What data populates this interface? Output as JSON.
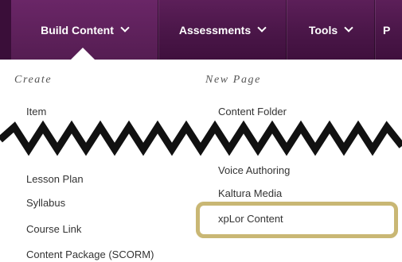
{
  "menu": {
    "tabs": [
      {
        "label": "Build Content",
        "active": true
      },
      {
        "label": "Assessments"
      },
      {
        "label": "Tools"
      },
      {
        "label": "P"
      }
    ]
  },
  "dropdown": {
    "create_heading": "Create",
    "new_page_heading": "New Page",
    "create_items": [
      "Item",
      "Lesson Plan",
      "Syllabus",
      "Course Link",
      "Content Package (SCORM)"
    ],
    "new_page_items": [
      "Content Folder",
      "Voice Authoring",
      "Kaltura Media",
      "xpLor Content"
    ]
  },
  "colors": {
    "menubar": "#4a1648",
    "highlight_border": "#c9b774"
  }
}
